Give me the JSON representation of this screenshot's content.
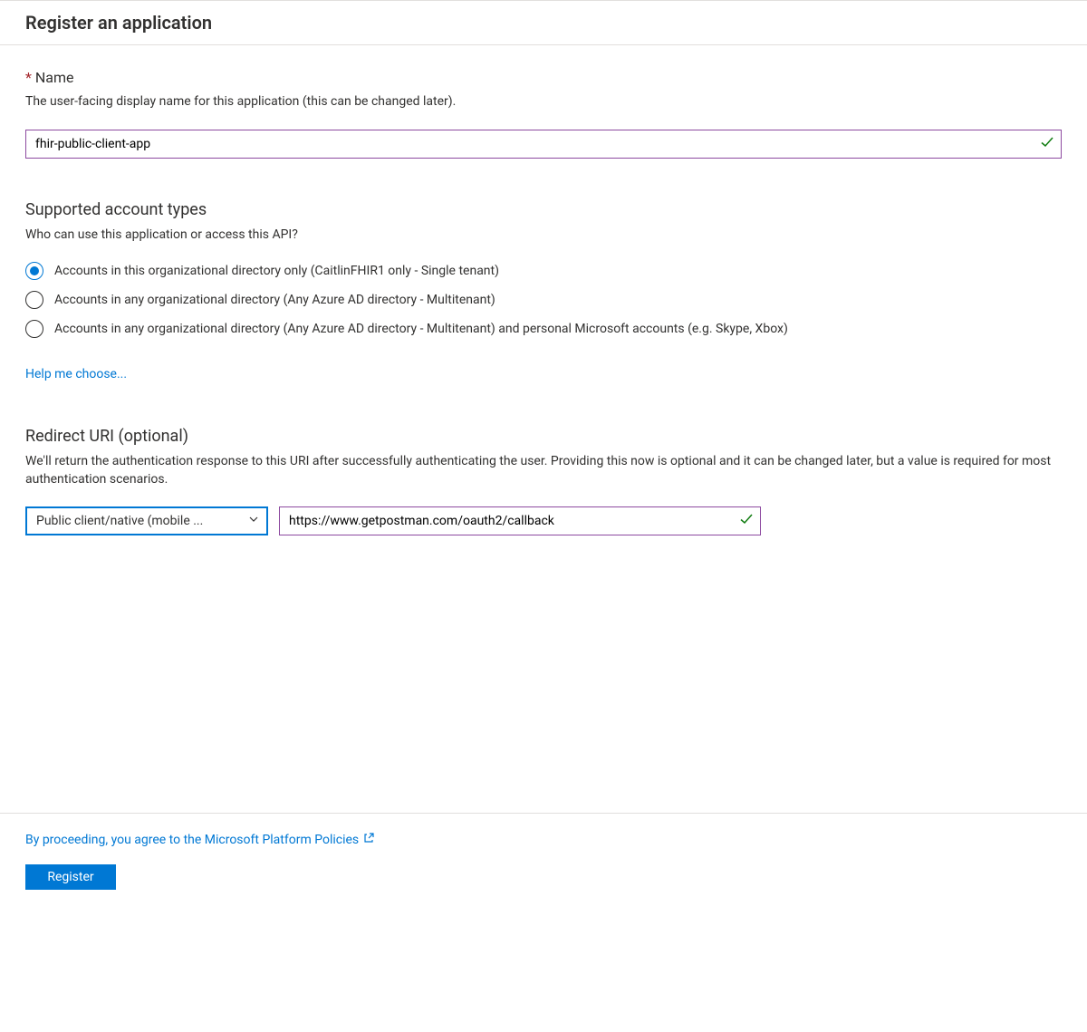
{
  "header": {
    "title": "Register an application"
  },
  "nameSection": {
    "label": "Name",
    "description": "The user-facing display name for this application (this can be changed later).",
    "value": "fhir-public-client-app"
  },
  "accountTypes": {
    "heading": "Supported account types",
    "description": "Who can use this application or access this API?",
    "options": [
      "Accounts in this organizational directory only (CaitlinFHIR1 only - Single tenant)",
      "Accounts in any organizational directory (Any Azure AD directory - Multitenant)",
      "Accounts in any organizational directory (Any Azure AD directory - Multitenant) and personal Microsoft accounts (e.g. Skype, Xbox)"
    ],
    "selectedIndex": 0,
    "helpLink": "Help me choose..."
  },
  "redirectUri": {
    "heading": "Redirect URI (optional)",
    "description": "We'll return the authentication response to this URI after successfully authenticating the user. Providing this now is optional and it can be changed later, but a value is required for most authentication scenarios.",
    "dropdownValue": "Public client/native (mobile ...",
    "uriValue": "https://www.getpostman.com/oauth2/callback"
  },
  "footer": {
    "policyLink": "By proceeding, you agree to the Microsoft Platform Policies",
    "registerButton": "Register"
  }
}
